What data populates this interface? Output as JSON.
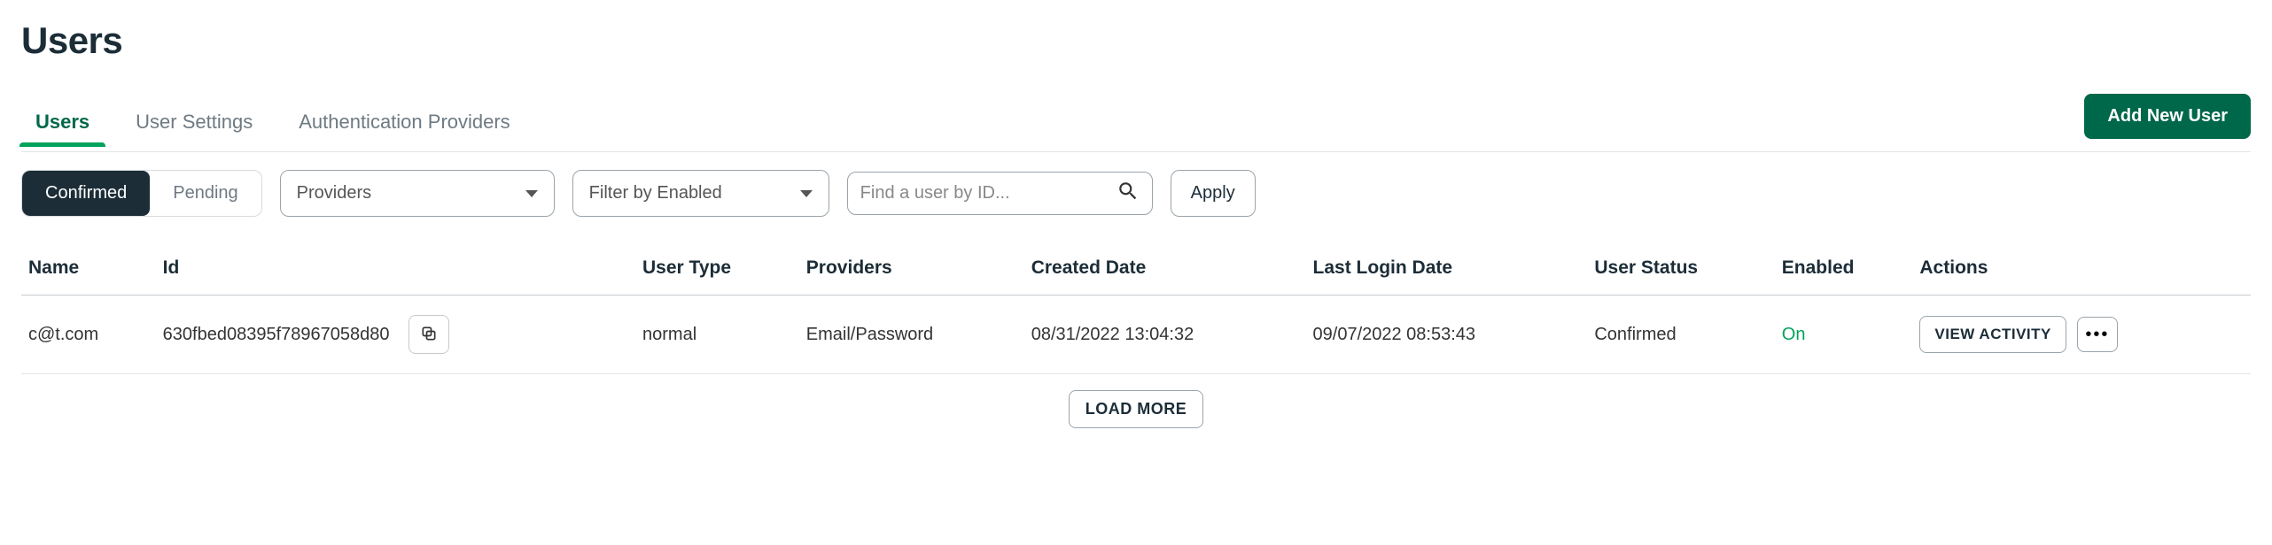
{
  "page_title": "Users",
  "tabs": [
    "Users",
    "User Settings",
    "Authentication Providers"
  ],
  "active_tab": 0,
  "add_user_label": "Add New User",
  "seg": {
    "confirmed": "Confirmed",
    "pending": "Pending",
    "active": "confirmed"
  },
  "providers_select": "Providers",
  "enabled_select": "Filter by Enabled",
  "search_placeholder": "Find a user by ID...",
  "apply_label": "Apply",
  "columns": [
    "Name",
    "Id",
    "User Type",
    "Providers",
    "Created Date",
    "Last Login Date",
    "User Status",
    "Enabled",
    "Actions"
  ],
  "rows": [
    {
      "name": "c@t.com",
      "id": "630fbed08395f78967058d80",
      "user_type": "normal",
      "providers": "Email/Password",
      "created": "08/31/2022 13:04:32",
      "last_login": "09/07/2022 08:53:43",
      "status": "Confirmed",
      "enabled": "On"
    }
  ],
  "view_activity_label": "VIEW ACTIVITY",
  "load_more_label": "LOAD MORE"
}
